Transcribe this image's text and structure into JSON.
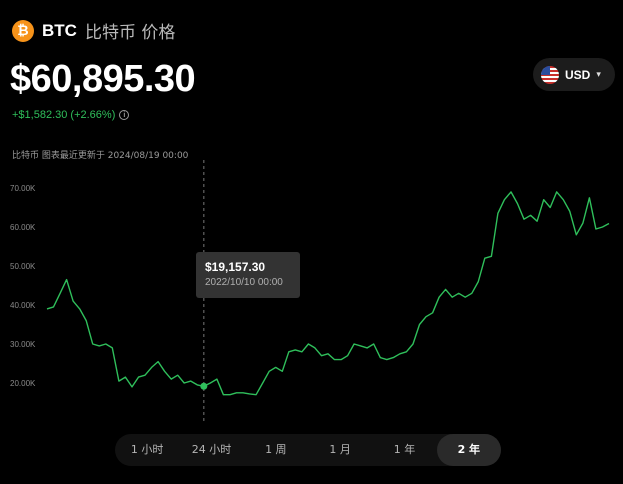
{
  "header": {
    "logo_glyph": "₿",
    "symbol": "BTC",
    "title": "比特币 价格"
  },
  "price": {
    "value": "$60,895.30",
    "change": "+$1,582.30 (+2.66%)"
  },
  "currency": {
    "label": "USD",
    "flag_icon": "us-flag-icon"
  },
  "updated_text": "比特币 图表最近更新于 2024/08/19 00:00",
  "tooltip": {
    "value": "$19,157.30",
    "date": "2022/10/10 00:00"
  },
  "tabs": [
    {
      "label": "1 小时",
      "active": false
    },
    {
      "label": "24 小时",
      "active": false
    },
    {
      "label": "1 周",
      "active": false
    },
    {
      "label": "1 月",
      "active": false
    },
    {
      "label": "1 年",
      "active": false
    },
    {
      "label": "2 年",
      "active": true
    }
  ],
  "colors": {
    "line": "#2fbf5b",
    "up": "#2fbf5b",
    "brand": "#f7931a"
  },
  "chart_data": {
    "type": "line",
    "title": "",
    "xlabel": "",
    "ylabel": "",
    "ylim": [
      10000,
      75000
    ],
    "yticks": [
      20000,
      30000,
      40000,
      50000,
      60000,
      70000
    ],
    "ytick_labels": [
      "20.00K",
      "30.00K",
      "40.00K",
      "50.00K",
      "60.00K",
      "70.00K"
    ],
    "grid": false,
    "series": [
      {
        "values": [
          39000,
          39500,
          43000,
          46500,
          41000,
          39000,
          36000,
          30000,
          29500,
          30000,
          29000,
          20500,
          21500,
          19000,
          21500,
          22000,
          24000,
          25500,
          23000,
          21000,
          22000,
          20000,
          20500,
          19500,
          19157,
          20000,
          21000,
          17000,
          17000,
          17500,
          17500,
          17200,
          17000,
          20000,
          23000,
          24000,
          23000,
          28000,
          28500,
          28000,
          30000,
          29000,
          27000,
          27500,
          26000,
          26000,
          27000,
          30000,
          29500,
          29000,
          30000,
          26500,
          26000,
          26500,
          27500,
          28000,
          30000,
          35000,
          37000,
          38000,
          42000,
          44000,
          42000,
          43000,
          42000,
          43000,
          46000,
          52000,
          52500,
          63500,
          67000,
          69000,
          66000,
          62000,
          63000,
          61500,
          67000,
          65000,
          69000,
          67000,
          64000,
          58000,
          61000,
          67500,
          59500,
          60000,
          60895
        ]
      }
    ],
    "highlight": {
      "index": 24,
      "value": 19157.3,
      "date": "2022/10/10 00:00"
    }
  }
}
